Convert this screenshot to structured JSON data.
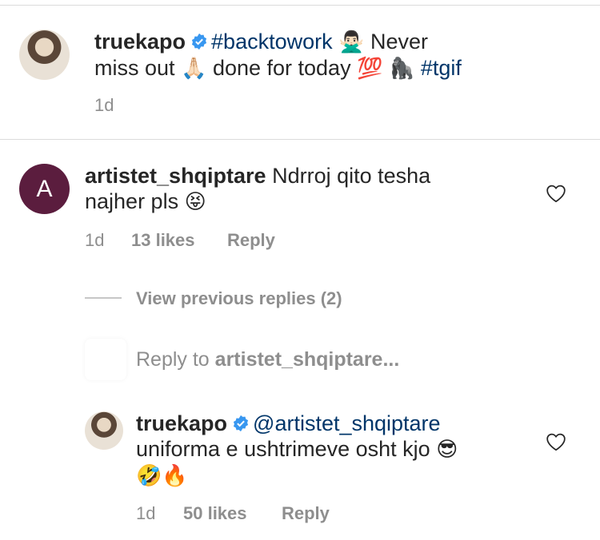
{
  "post": {
    "username": "truekapo",
    "hashtag1": "#backtowork",
    "emoji1": "🙅🏻‍♂️",
    "text1": "Never",
    "text2": "miss out",
    "emoji2": "🙏🏻",
    "text3": "done for today",
    "emoji3": "💯",
    "emoji4": "🦍",
    "hashtag2": "#tgif",
    "time": "1d"
  },
  "comment": {
    "username": "artistet_shqiptare",
    "text_line1": "Ndrroj qito tesha",
    "text_line2": "najher pls",
    "emoji": "😝",
    "avatar_letter": "A",
    "time": "1d",
    "likes": "13 likes",
    "reply_label": "Reply"
  },
  "view_previous": "View previous replies (2)",
  "reply_input": {
    "prefix": "Reply to",
    "target": "artistet_shqiptare..."
  },
  "reply": {
    "username": "truekapo",
    "mention": "@artistet_shqiptare",
    "text_line2": "uniforma e ushtrimeve osht kjo",
    "emoji1": "😎",
    "emoji2": "🤣",
    "emoji3": "🔥",
    "time": "1d",
    "likes": "50 likes",
    "reply_label": "Reply"
  },
  "colors": {
    "hashtag": "#003569",
    "verified": "#3897f0",
    "meta": "#8e8e8e",
    "brand_avatar": "#5b1d3e"
  }
}
